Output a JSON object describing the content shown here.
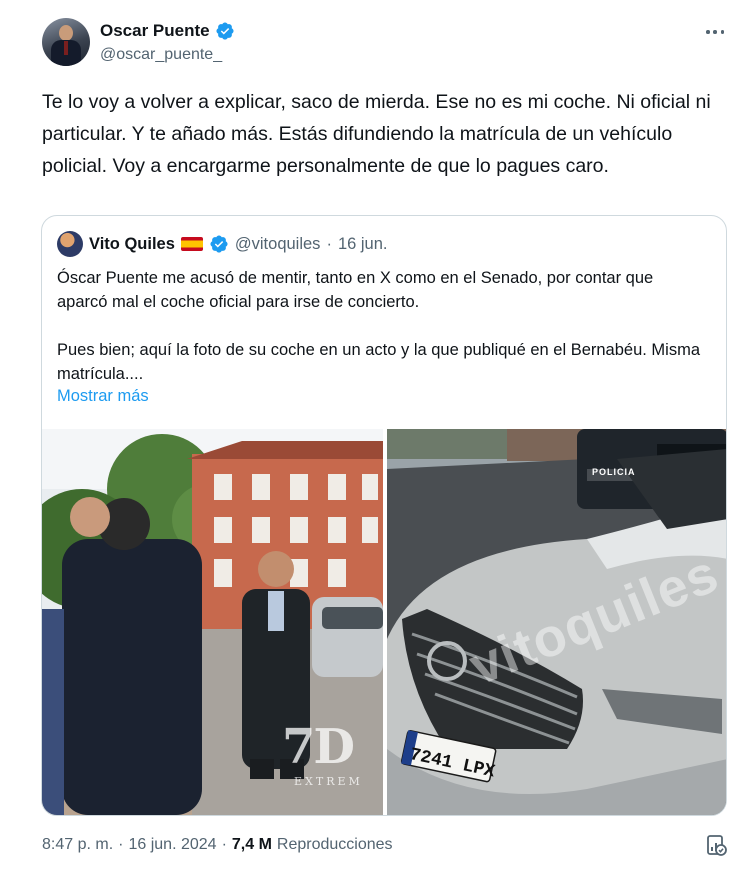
{
  "author": {
    "name": "Oscar Puente",
    "handle": "@oscar_puente_"
  },
  "tweet": {
    "text": "Te lo voy a volver a explicar, saco de mierda. Ese no es mi coche. Ni oficial ni particular. Y te añado más. Estás difundiendo la matrícula de un vehículo policial. Voy a encargarme personalmente de que lo pagues caro."
  },
  "quote": {
    "name": "Vito Quiles",
    "handle": "@vitoquiles",
    "separator": "·",
    "date": "16 jun.",
    "paragraph1": "Óscar Puente me acusó de mentir, tanto en X como en el Senado, por contar que aparcó mal el coche oficial para irse de concierto.",
    "paragraph2": "Pues bien; aquí la foto de su coche en un acto y la que publiqué en el Bernabéu. Misma matrícula....",
    "show_more": "Mostrar más",
    "media": {
      "left_watermark": "7D",
      "left_watermark_sub": "EXTREM",
      "right_watermark": "vitoquiles",
      "van_label": "POLICIA",
      "plate": "7241 LPX"
    }
  },
  "meta": {
    "time": "8:47 p. m.",
    "sep1": "·",
    "date": "16 jun. 2024",
    "sep2": "·",
    "views_count": "7,4 M",
    "views_label": "Reproducciones"
  },
  "colors": {
    "accent": "#1d9bf0",
    "secondary_text": "#536471",
    "border": "#cfd9de"
  },
  "icons": [
    "verified-badge-icon",
    "more-options-icon",
    "spain-flag-icon",
    "analytics-icon"
  ]
}
